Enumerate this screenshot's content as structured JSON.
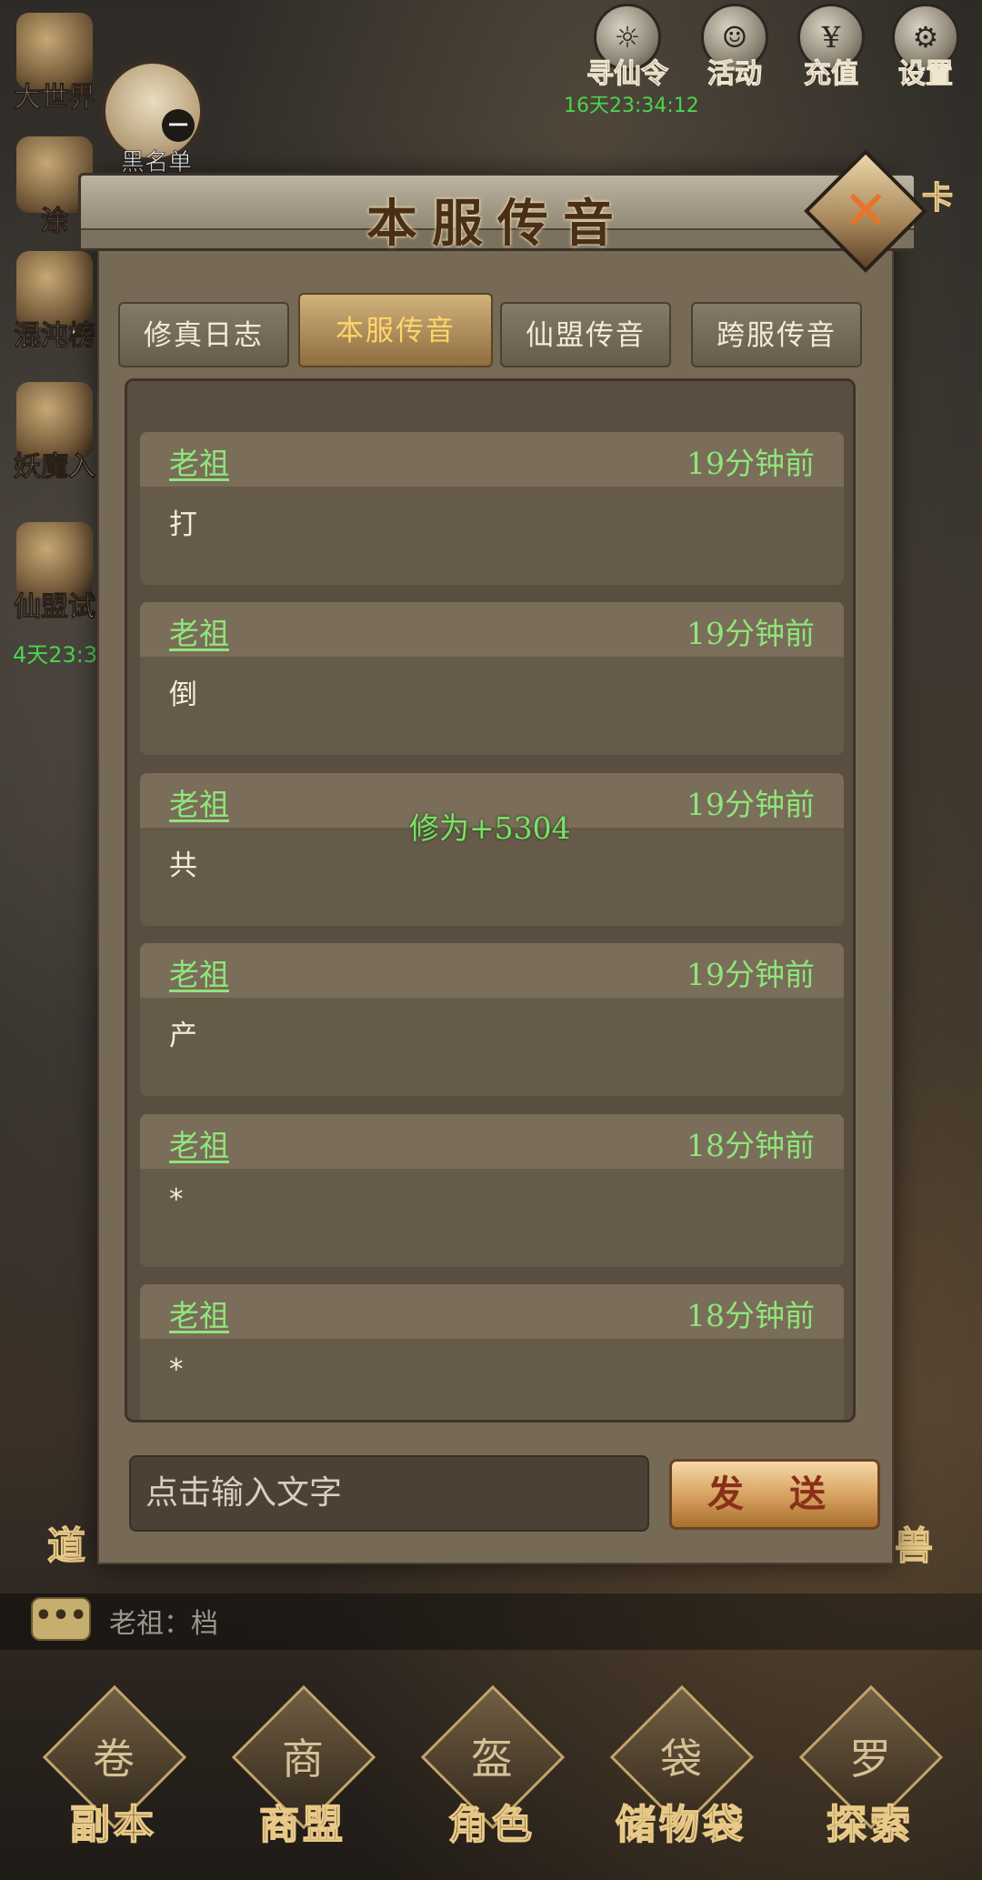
{
  "top_icons": [
    {
      "name": "seek-immortal-order",
      "label": "寻仙令",
      "glyph": "☼"
    },
    {
      "name": "activity",
      "label": "活动",
      "glyph": "☺"
    },
    {
      "name": "recharge",
      "label": "充值",
      "glyph": "¥"
    },
    {
      "name": "settings",
      "label": "设置",
      "glyph": "⚙"
    }
  ],
  "top_timer": "16天23:34:12",
  "left_icons": [
    {
      "label": "大世界"
    },
    {
      "label": "涂"
    },
    {
      "label": "混沌榜"
    },
    {
      "label": "妖魔入"
    },
    {
      "label": "仙盟试"
    }
  ],
  "left_timer": "4天23:3",
  "blacklist_label": "黑名单",
  "dialog": {
    "title": "本服传音",
    "close_glyph": "✕",
    "tabs": [
      {
        "label": "修真日志",
        "active": false
      },
      {
        "label": "本服传音",
        "active": true
      },
      {
        "label": "仙盟传音",
        "active": false
      },
      {
        "label": "跨服传音",
        "active": false
      }
    ],
    "messages": [
      {
        "sender": "老祖",
        "time": "19分钟前",
        "text": "打"
      },
      {
        "sender": "老祖",
        "time": "19分钟前",
        "text": "倒"
      },
      {
        "sender": "老祖",
        "time": "19分钟前",
        "text": "共"
      },
      {
        "sender": "老祖",
        "time": "19分钟前",
        "text": "产"
      },
      {
        "sender": "老祖",
        "time": "18分钟前",
        "text": "*"
      },
      {
        "sender": "老祖",
        "time": "18分钟前",
        "text": "*"
      }
    ],
    "floating_gain": "修为+5304",
    "input_placeholder": "点击输入文字",
    "send_label": "发 送"
  },
  "side_labels": {
    "left": "道",
    "right": "兽",
    "right_top": "卡"
  },
  "chat": {
    "icon_glyph": "•••",
    "text": "老祖：档"
  },
  "bottom_nav": [
    {
      "label": "副本",
      "glyph": "卷"
    },
    {
      "label": "商盟",
      "glyph": "商"
    },
    {
      "label": "角色",
      "glyph": "盔"
    },
    {
      "label": "储物袋",
      "glyph": "袋"
    },
    {
      "label": "探索",
      "glyph": "罗"
    }
  ]
}
